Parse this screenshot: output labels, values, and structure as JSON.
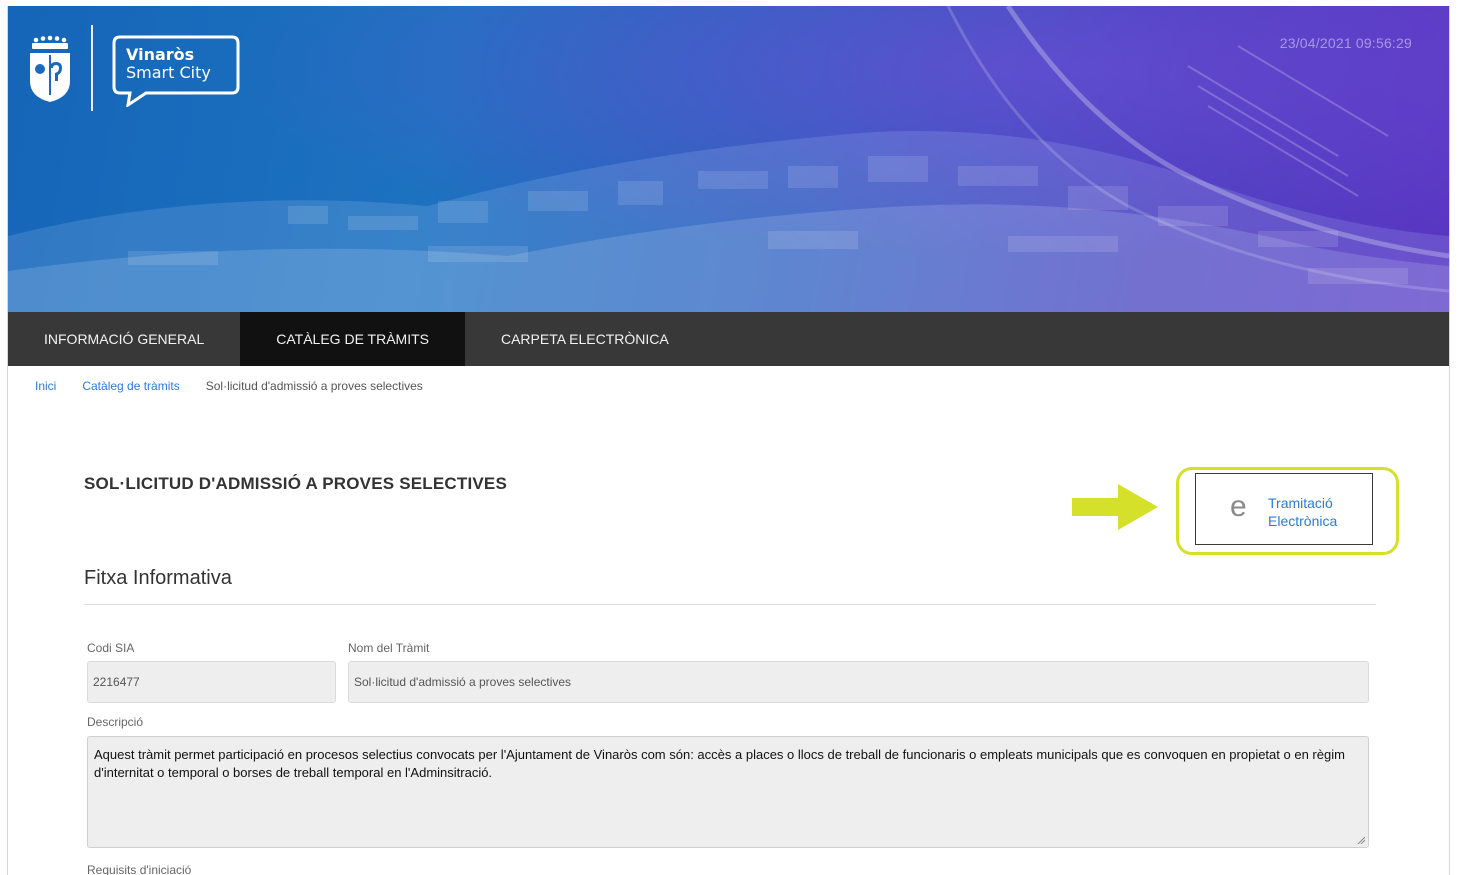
{
  "header": {
    "brand_line1": "Vinaròs",
    "brand_line2": "Smart City",
    "timestamp": "23/04/2021 09:56:29"
  },
  "nav": {
    "items": [
      {
        "label": "INFORMACIÓ GENERAL",
        "active": false
      },
      {
        "label": "CATÀLEG DE TRÀMITS",
        "active": true
      },
      {
        "label": "CARPETA ELECTRÒNICA",
        "active": false
      }
    ]
  },
  "breadcrumb": {
    "items": [
      "Inici",
      "Catàleg de tràmits",
      "Sol·licitud d'admissió a proves selectives"
    ]
  },
  "page": {
    "title": "SOL·LICITUD D'ADMISSIÓ A PROVES SELECTIVES"
  },
  "action": {
    "icon_glyph": "e",
    "label_line1": "Tramitació",
    "label_line2": "Electrònica"
  },
  "fitxa": {
    "section_title": "Fitxa Informativa",
    "codi_sia_label": "Codi SIA",
    "codi_sia_value": "2216477",
    "nom_label": "Nom del Tràmit",
    "nom_value": "Sol·licitud d'admissió a proves selectives",
    "descripcio_label": "Descripció",
    "descripcio_value": "Aquest tràmit permet participació en procesos selectius convocats per l'Ajuntament de Vinaròs com són: accès a places o llocs de treball de funcionaris o empleats municipals que es convoquen en propietat o en règim d'internitat o temporal o borses de treball temporal en l'Adminsitració.",
    "requisits_label": "Requisits d'iniciació"
  },
  "colors": {
    "accent": "#2c7bd6",
    "nav_bg": "#383838",
    "nav_active": "#111111",
    "highlight": "#d4e02a"
  }
}
